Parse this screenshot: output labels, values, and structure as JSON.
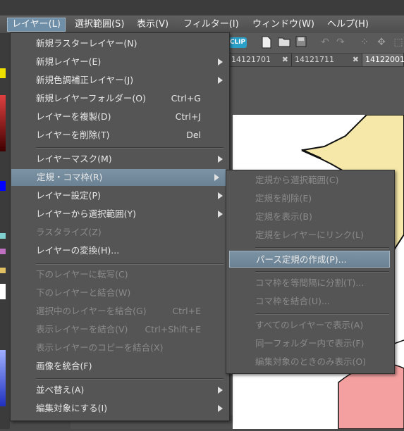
{
  "menubar": {
    "items": [
      {
        "label": "レイヤー(L)",
        "active": true
      },
      {
        "label": "選択範囲(S)"
      },
      {
        "label": "表示(V)"
      },
      {
        "label": "フィルター(I)"
      },
      {
        "label": "ウィンドウ(W)"
      },
      {
        "label": "ヘルプ(H)"
      }
    ]
  },
  "tabs": [
    {
      "label": "14121701"
    },
    {
      "label": "14121711"
    },
    {
      "label": "14122001"
    }
  ],
  "tab_close_glyph": "✖",
  "toolbar_logo": "CLIP",
  "layer_menu": {
    "items": [
      {
        "label": "新規ラスターレイヤー(N)",
        "shortcut": ""
      },
      {
        "label": "新規レイヤー(E)",
        "submenu": true
      },
      {
        "label": "新規色調補正レイヤー(J)",
        "submenu": true
      },
      {
        "label": "新規レイヤーフォルダー(O)",
        "shortcut": "Ctrl+G"
      },
      {
        "label": "レイヤーを複製(D)",
        "shortcut": "Ctrl+J"
      },
      {
        "label": "レイヤーを削除(T)",
        "shortcut": "Del"
      },
      {
        "label": "レイヤーマスク(M)",
        "submenu": true
      },
      {
        "label": "定規・コマ枠(R)",
        "submenu": true,
        "highlighted": true
      },
      {
        "label": "レイヤー設定(P)",
        "submenu": true
      },
      {
        "label": "レイヤーから選択範囲(Y)",
        "submenu": true
      },
      {
        "label": "ラスタライズ(Z)",
        "disabled": true
      },
      {
        "label": "レイヤーの変換(H)..."
      },
      {
        "label": "下のレイヤーに転写(C)",
        "disabled": true
      },
      {
        "label": "下のレイヤーと結合(W)",
        "disabled": true
      },
      {
        "label": "選択中のレイヤーを結合(G)",
        "shortcut": "Ctrl+E",
        "disabled": true
      },
      {
        "label": "表示レイヤーを結合(V)",
        "shortcut": "Ctrl+Shift+E",
        "disabled": true
      },
      {
        "label": "表示レイヤーのコピーを結合(X)",
        "disabled": true
      },
      {
        "label": "画像を統合(F)"
      },
      {
        "label": "並べ替え(A)",
        "submenu": true
      },
      {
        "label": "編集対象にする(I)",
        "submenu": true
      }
    ]
  },
  "ruler_submenu": {
    "items": [
      {
        "label": "定規から選択範囲(C)",
        "disabled": true
      },
      {
        "label": "定規を削除(E)",
        "disabled": true
      },
      {
        "label": "定規を表示(B)",
        "disabled": true
      },
      {
        "label": "定規をレイヤーにリンク(L)",
        "disabled": true
      },
      {
        "label": "パース定規の作成(P)...",
        "highlighted": true
      },
      {
        "label": "コマ枠を等間隔に分割(T)...",
        "disabled": true
      },
      {
        "label": "コマ枠を結合(U)...",
        "disabled": true
      },
      {
        "label": "すべてのレイヤーで表示(A)",
        "disabled": true
      },
      {
        "label": "同一フォルダー内で表示(F)",
        "disabled": true
      },
      {
        "label": "編集対象のときのみ表示(O)",
        "disabled": true
      }
    ]
  },
  "colors": {
    "highlight": "#6f8fa8",
    "menu_bg": "#555555",
    "disabled_text": "#8a8a8a",
    "character_fill": "#f4a0a0",
    "character_yellow": "#f6e8a8"
  }
}
